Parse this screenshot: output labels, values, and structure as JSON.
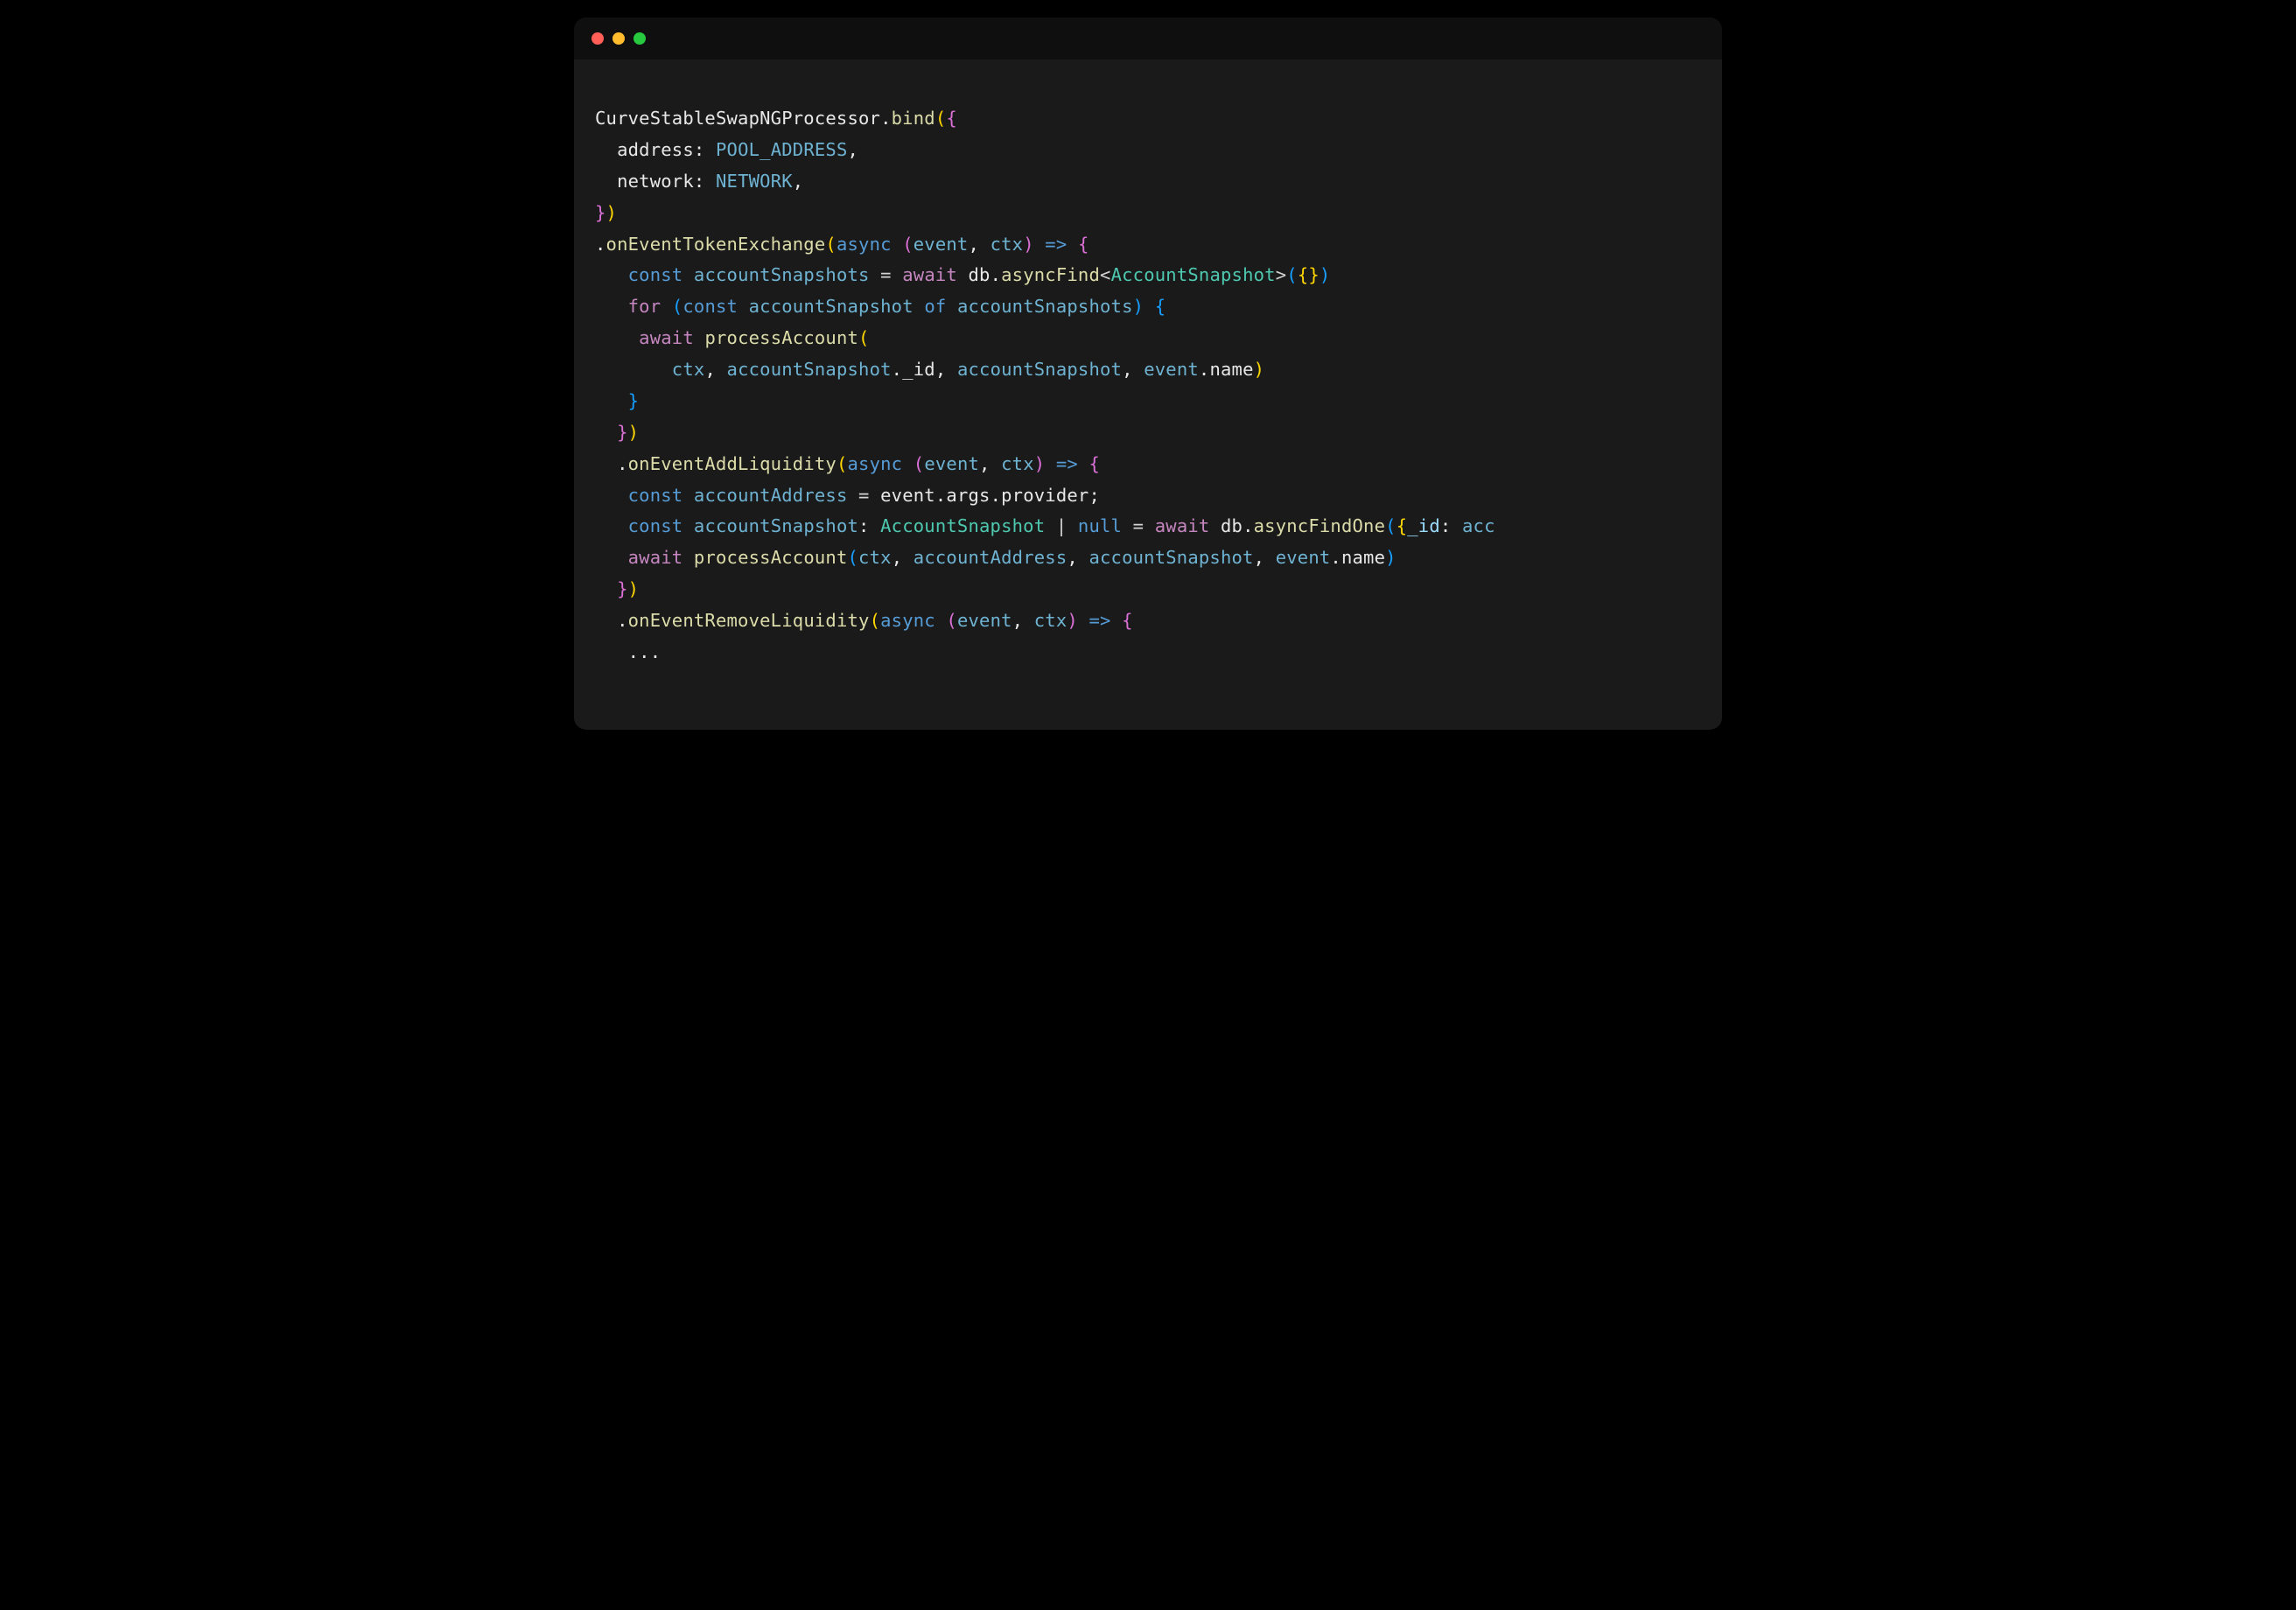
{
  "titlebar": {
    "red": "close",
    "yellow": "minimize",
    "green": "maximize"
  },
  "code": {
    "l1": {
      "class_name": "CurveStableSwapNGProcessor",
      "method": "bind"
    },
    "l2": {
      "key": "address",
      "val": "POOL_ADDRESS"
    },
    "l3": {
      "key": "network",
      "val": "NETWORK"
    },
    "l5": {
      "method": "onEventTokenExchange",
      "kw": "async",
      "p1": "event",
      "p2": "ctx"
    },
    "l6": {
      "kw_const": "const",
      "var": "accountSnapshots",
      "kw_await": "await",
      "obj": "db",
      "method": "asyncFind",
      "type": "AccountSnapshot"
    },
    "l7": {
      "kw_for": "for",
      "kw_const": "const",
      "iter": "accountSnapshot",
      "kw_of": "of",
      "coll": "accountSnapshots"
    },
    "l8": {
      "kw_await": "await",
      "func": "processAccount"
    },
    "l9": {
      "a1": "ctx",
      "a2": "accountSnapshot",
      "a2f": "_id",
      "a3": "accountSnapshot",
      "a4": "event",
      "a4f": "name"
    },
    "l12": {
      "method": "onEventAddLiquidity",
      "kw": "async",
      "p1": "event",
      "p2": "ctx"
    },
    "l13": {
      "kw_const": "const",
      "var": "accountAddress",
      "o1": "event",
      "o2": "args",
      "o3": "provider"
    },
    "l14": {
      "kw_const": "const",
      "var": "accountSnapshot",
      "type": "AccountSnapshot",
      "null": "null",
      "kw_await": "await",
      "obj": "db",
      "method": "asyncFindOne",
      "arg_key": "_id",
      "arg_val": "acc"
    },
    "l15": {
      "kw_await": "await",
      "func": "processAccount",
      "a1": "ctx",
      "a2": "accountAddress",
      "a3": "accountSnapshot",
      "a4": "event",
      "a4f": "name"
    },
    "l17": {
      "method": "onEventRemoveLiquidity",
      "kw": "async",
      "p1": "event",
      "p2": "ctx"
    },
    "l18": {
      "ellipsis": "..."
    }
  }
}
